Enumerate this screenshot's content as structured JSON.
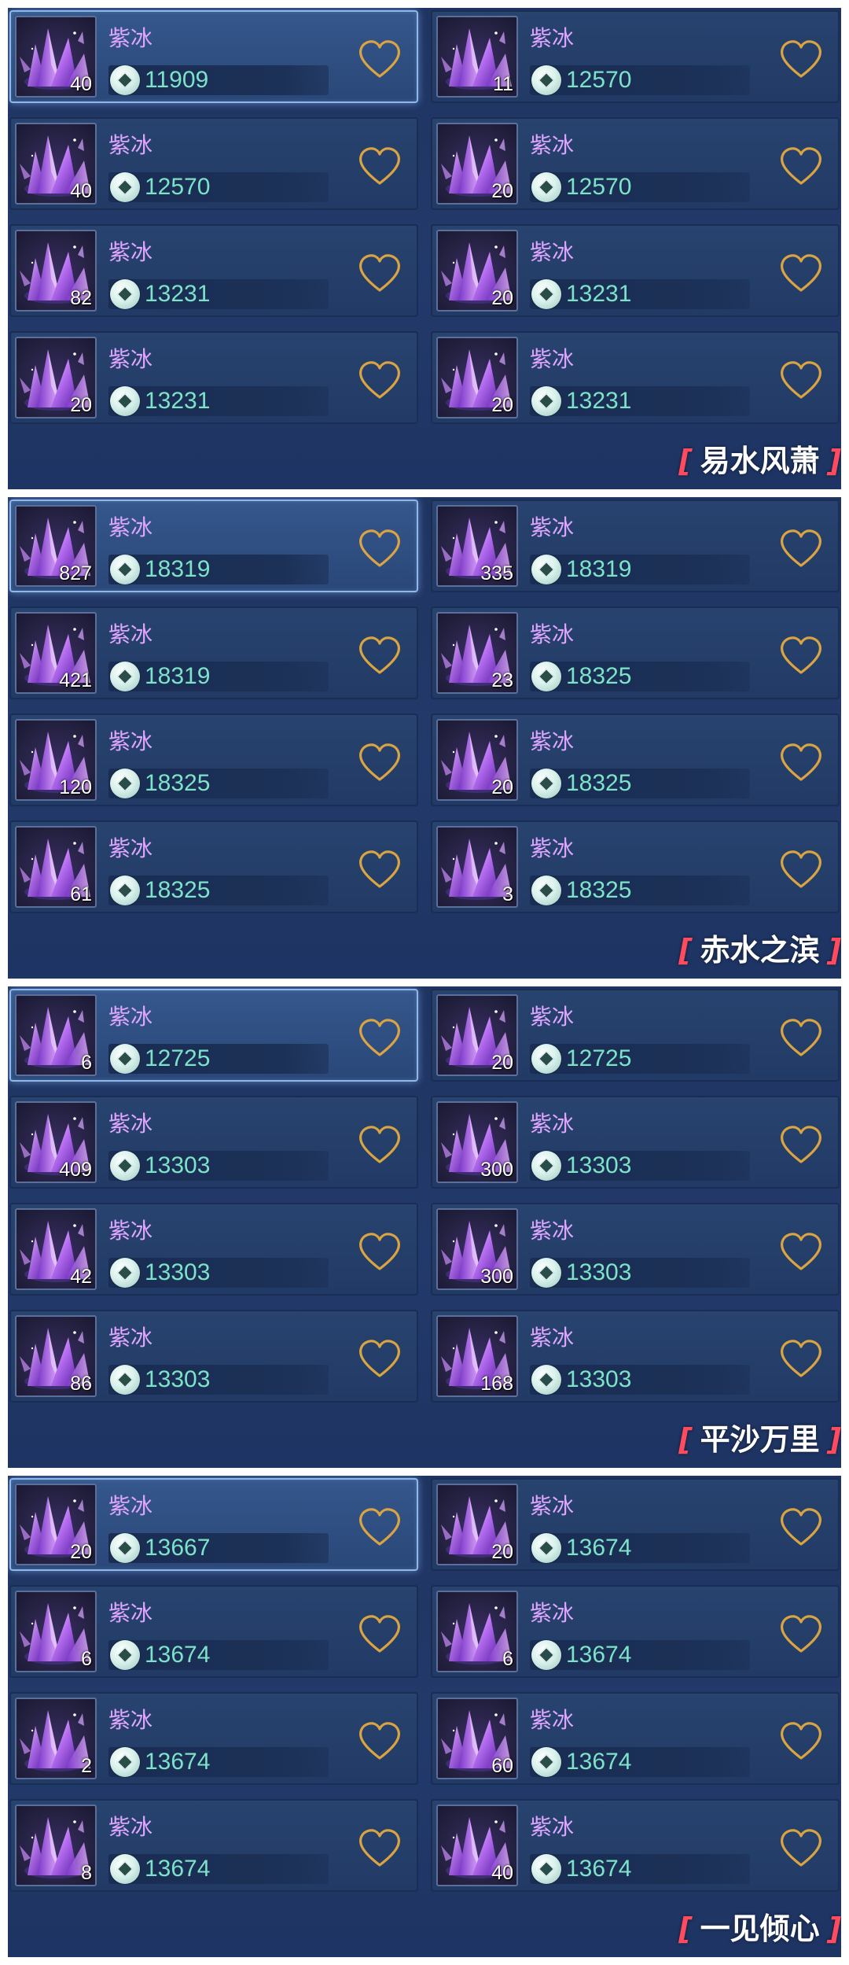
{
  "item_name": "紫冰",
  "sections": [
    {
      "label": "易水风萧",
      "items": [
        {
          "qty": "40",
          "price": "11909",
          "selected": true
        },
        {
          "qty": "11",
          "price": "12570",
          "selected": false
        },
        {
          "qty": "40",
          "price": "12570",
          "selected": false
        },
        {
          "qty": "20",
          "price": "12570",
          "selected": false
        },
        {
          "qty": "82",
          "price": "13231",
          "selected": false
        },
        {
          "qty": "20",
          "price": "13231",
          "selected": false
        },
        {
          "qty": "20",
          "price": "13231",
          "selected": false
        },
        {
          "qty": "20",
          "price": "13231",
          "selected": false
        }
      ]
    },
    {
      "label": "赤水之滨",
      "items": [
        {
          "qty": "827",
          "price": "18319",
          "selected": true
        },
        {
          "qty": "335",
          "price": "18319",
          "selected": false
        },
        {
          "qty": "421",
          "price": "18319",
          "selected": false
        },
        {
          "qty": "23",
          "price": "18325",
          "selected": false
        },
        {
          "qty": "120",
          "price": "18325",
          "selected": false
        },
        {
          "qty": "20",
          "price": "18325",
          "selected": false
        },
        {
          "qty": "61",
          "price": "18325",
          "selected": false
        },
        {
          "qty": "3",
          "price": "18325",
          "selected": false
        }
      ]
    },
    {
      "label": "平沙万里",
      "items": [
        {
          "qty": "6",
          "price": "12725",
          "selected": true
        },
        {
          "qty": "20",
          "price": "12725",
          "selected": false
        },
        {
          "qty": "409",
          "price": "13303",
          "selected": false
        },
        {
          "qty": "300",
          "price": "13303",
          "selected": false
        },
        {
          "qty": "42",
          "price": "13303",
          "selected": false
        },
        {
          "qty": "300",
          "price": "13303",
          "selected": false
        },
        {
          "qty": "86",
          "price": "13303",
          "selected": false
        },
        {
          "qty": "168",
          "price": "13303",
          "selected": false
        }
      ]
    },
    {
      "label": "一见倾心",
      "items": [
        {
          "qty": "20",
          "price": "13667",
          "selected": true
        },
        {
          "qty": "20",
          "price": "13674",
          "selected": false
        },
        {
          "qty": "6",
          "price": "13674",
          "selected": false
        },
        {
          "qty": "6",
          "price": "13674",
          "selected": false
        },
        {
          "qty": "2",
          "price": "13674",
          "selected": false
        },
        {
          "qty": "60",
          "price": "13674",
          "selected": false
        },
        {
          "qty": "8",
          "price": "13674",
          "selected": false
        },
        {
          "qty": "40",
          "price": "13674",
          "selected": false
        }
      ]
    }
  ],
  "colors": {
    "item_name": "#e0a6ff",
    "price": "#7de3c8",
    "heart": "#d9a441",
    "bracket": "#ff4b5f",
    "panel": "#223a6b"
  },
  "icons": {
    "item": "purple-crystal-icon",
    "currency": "jade-coin-icon",
    "favorite": "heart-outline-icon"
  }
}
